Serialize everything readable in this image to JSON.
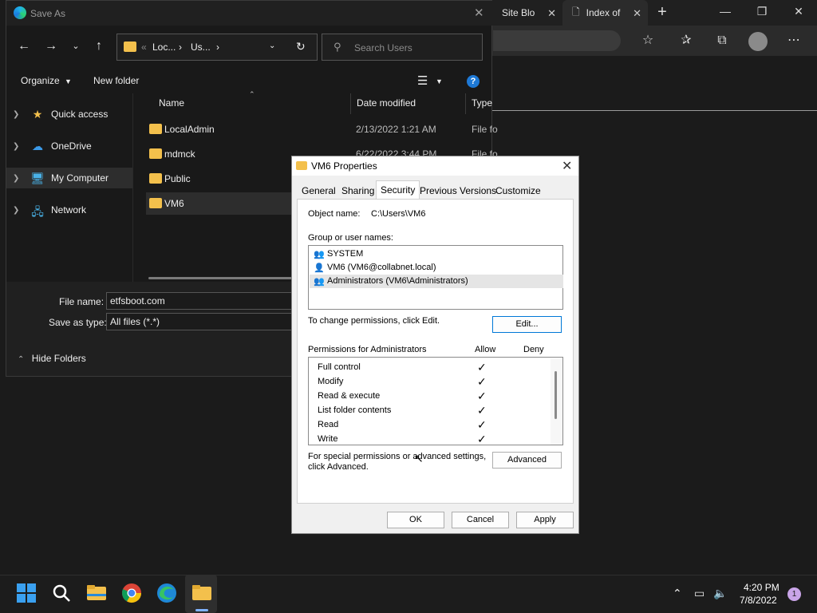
{
  "browser": {
    "tabs": [
      {
        "label": "Site Blo"
      },
      {
        "label": "Index of"
      }
    ],
    "new_tab_icon": "plus-icon",
    "toolbar_icons": [
      "favorite-add-icon",
      "favorites-icon",
      "collections-icon",
      "profile-avatar",
      "more-icon"
    ]
  },
  "saveas": {
    "title": "Save As",
    "path": {
      "seg1": "Loc...",
      "seg2": "Us..."
    },
    "search_placeholder": "Search Users",
    "commands": {
      "organize": "Organize",
      "new_folder": "New folder"
    },
    "nav": [
      {
        "label": "Quick access",
        "icon": "star-icon"
      },
      {
        "label": "OneDrive",
        "icon": "cloud-icon"
      },
      {
        "label": "My Computer",
        "icon": "computer-icon"
      },
      {
        "label": "Network",
        "icon": "network-icon"
      }
    ],
    "columns": {
      "name": "Name",
      "date": "Date modified",
      "type": "Type"
    },
    "files": [
      {
        "name": "LocalAdmin",
        "date": "2/13/2022 1:21 AM",
        "type": "File fo"
      },
      {
        "name": "mdmck",
        "date": "6/22/2022 3:44 PM",
        "type": "File fo"
      },
      {
        "name": "Public",
        "date": "",
        "type": ""
      },
      {
        "name": "VM6",
        "date": "",
        "type": ""
      }
    ],
    "file_name_label": "File name:",
    "file_name_value": "etfsboot.com",
    "save_type_label": "Save as type:",
    "save_type_value": "All files (*.*)",
    "hide_folders": "Hide Folders"
  },
  "props": {
    "title": "VM6 Properties",
    "tabs": [
      "General",
      "Sharing",
      "Security",
      "Previous Versions",
      "Customize"
    ],
    "object_name_label": "Object name:",
    "object_name_value": "C:\\Users\\VM6",
    "group_label": "Group or user names:",
    "groups": [
      {
        "label": "SYSTEM",
        "icon": "users-icon"
      },
      {
        "label": "VM6 (VM6@collabnet.local)",
        "icon": "user-icon"
      },
      {
        "label": "Administrators (VM6\\Administrators)",
        "icon": "users-icon"
      }
    ],
    "change_text": "To change permissions, click Edit.",
    "edit_button": "Edit...",
    "perm_for": "Permissions for Administrators",
    "allow": "Allow",
    "deny": "Deny",
    "permissions": [
      {
        "name": "Full control",
        "allow": "✓"
      },
      {
        "name": "Modify",
        "allow": "✓"
      },
      {
        "name": "Read & execute",
        "allow": "✓"
      },
      {
        "name": "List folder contents",
        "allow": "✓"
      },
      {
        "name": "Read",
        "allow": "✓"
      },
      {
        "name": "Write",
        "allow": "✓"
      }
    ],
    "special_text_1": "For special permissions or advanced settings,",
    "special_text_2": "click Advanced.",
    "advanced_button": "Advanced",
    "ok": "OK",
    "cancel": "Cancel",
    "apply": "Apply"
  },
  "taskbar": {
    "time": "4:20 PM",
    "date": "7/8/2022",
    "notifications": "1"
  }
}
